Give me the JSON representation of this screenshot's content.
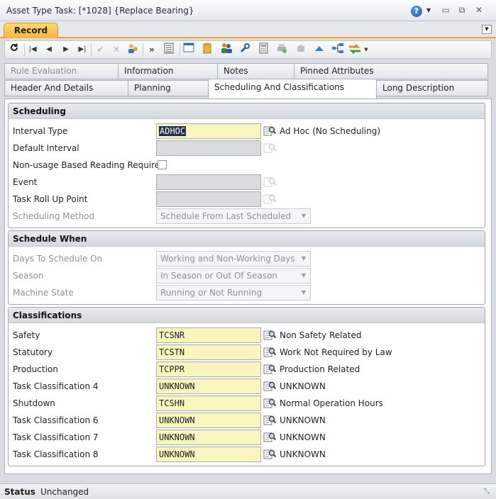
{
  "window": {
    "title": "Asset Type Task: [*1028] {Replace Bearing}"
  },
  "record_tab": {
    "label": "Record"
  },
  "tabs_row1": [
    {
      "label": "Rule Evaluation"
    },
    {
      "label": "Information"
    },
    {
      "label": "Notes"
    },
    {
      "label": "Pinned Attributes"
    }
  ],
  "tabs_row2": [
    {
      "label": "Header And Details"
    },
    {
      "label": "Planning"
    },
    {
      "label": "Scheduling And Classifications"
    },
    {
      "label": "Long Description"
    }
  ],
  "scheduling": {
    "header": "Scheduling",
    "interval_type": {
      "label": "Interval Type",
      "value": "ADHOC",
      "description": "Ad Hoc (No Scheduling)"
    },
    "default_interval": {
      "label": "Default Interval",
      "value": ""
    },
    "non_usage": {
      "label": "Non-usage Based Reading Required",
      "checked": false
    },
    "event": {
      "label": "Event",
      "value": ""
    },
    "task_roll_up_point": {
      "label": "Task Roll Up Point",
      "value": ""
    },
    "scheduling_method": {
      "label": "Scheduling Method",
      "value": "Schedule From Last Scheduled"
    }
  },
  "schedule_when": {
    "header": "Schedule When",
    "days_to_schedule_on": {
      "label": "Days To Schedule On",
      "value": "Working and Non-Working Days"
    },
    "season": {
      "label": "Season",
      "value": "In Season or Out Of Season"
    },
    "machine_state": {
      "label": "Machine State",
      "value": "Running or Not Running"
    }
  },
  "classifications": {
    "header": "Classifications",
    "rows": [
      {
        "label": "Safety",
        "value": "TCSNR",
        "description": "Non Safety Related"
      },
      {
        "label": "Statutory",
        "value": "TCSTN",
        "description": "Work Not Required by Law"
      },
      {
        "label": "Production",
        "value": "TCPPR",
        "description": "Production Related"
      },
      {
        "label": "Task Classification 4",
        "value": "UNKNOWN",
        "description": "UNKNOWN"
      },
      {
        "label": "Shutdown",
        "value": "TCSHN",
        "description": "Normal Operation Hours"
      },
      {
        "label": "Task Classification 6",
        "value": "UNKNOWN",
        "description": "UNKNOWN"
      },
      {
        "label": "Task Classification 7",
        "value": "UNKNOWN",
        "description": "UNKNOWN"
      },
      {
        "label": "Task Classification 8",
        "value": "UNKNOWN",
        "description": "UNKNOWN"
      }
    ]
  },
  "status": {
    "label": "Status",
    "value": "Unchanged"
  },
  "colors": {
    "accent": "#f7b43a",
    "required_field": "#f9f6bd",
    "disabled_field": "#d9dbdd"
  },
  "icons": {
    "window": [
      "help-icon",
      "minimize-icon",
      "restore-icon",
      "close-icon"
    ],
    "toolbar": [
      "refresh-icon",
      "first-record-icon",
      "previous-record-icon",
      "next-record-icon",
      "last-record-icon",
      "save-icon",
      "cancel-icon",
      "users-icon",
      "more-icon",
      "list-icon",
      "window-icon",
      "package-icon",
      "people-icon",
      "wrench-icon",
      "calculator-icon",
      "print-icon",
      "puzzle-icon",
      "up-icon",
      "hierarchy-icon",
      "sync-icon"
    ],
    "field": "lookup-icon"
  }
}
